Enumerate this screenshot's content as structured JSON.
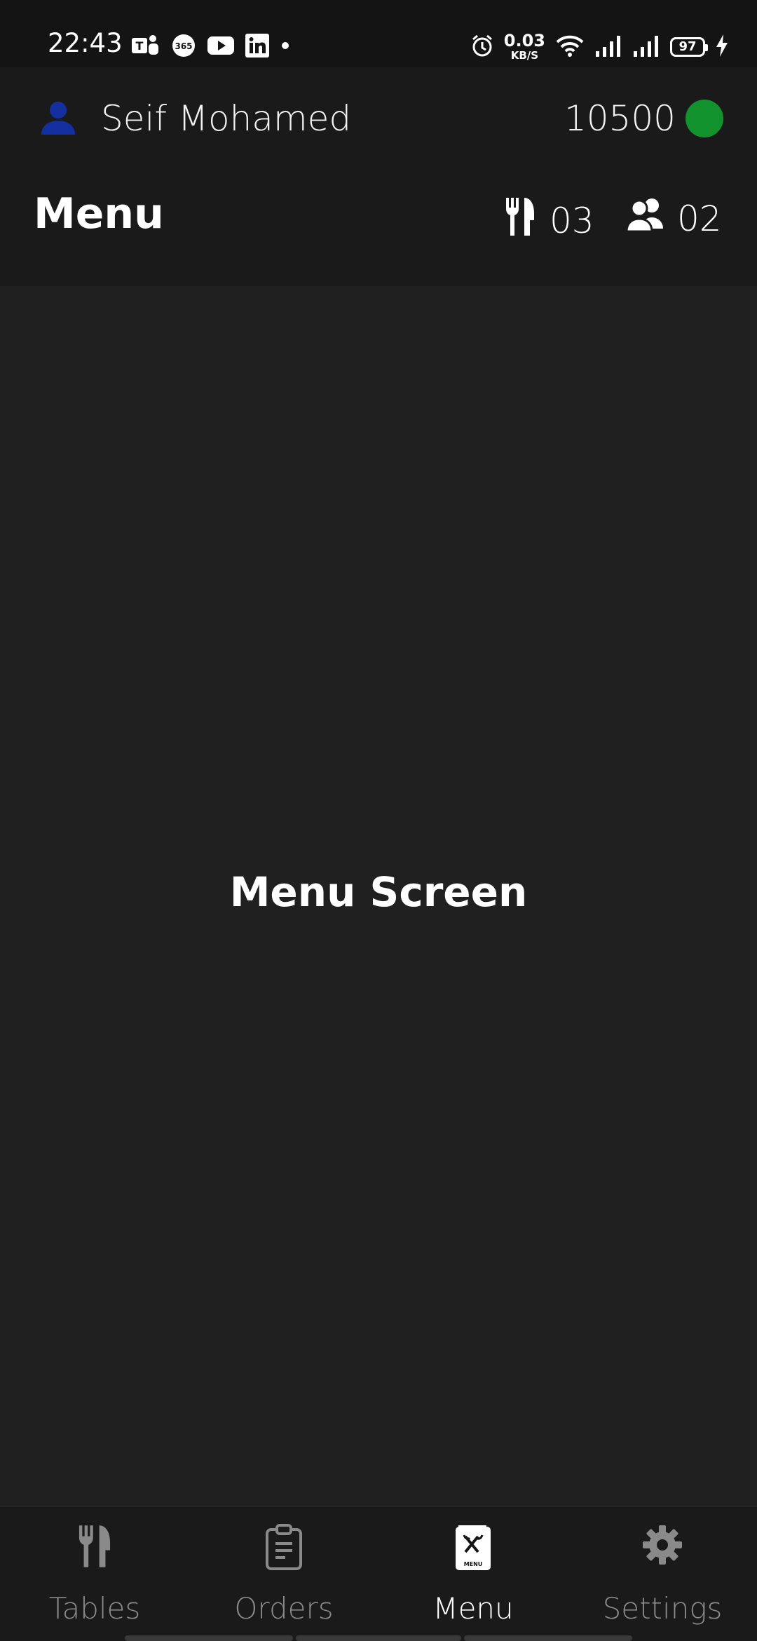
{
  "status_bar": {
    "time": "22:43",
    "notification_icons": [
      "teams-icon",
      "office-365-icon",
      "youtube-icon",
      "linkedin-icon",
      "dot-icon"
    ],
    "net_speed_value": "0.03",
    "net_speed_unit": "KB/S",
    "battery_level": "97",
    "charging": true
  },
  "header": {
    "user_name": "Seif Mohamed",
    "balance": "10500",
    "online_status_color": "#12922c",
    "avatar_color": "#1430a0",
    "title": "Menu",
    "tables_count": "03",
    "guests_count": "02"
  },
  "main": {
    "label": "Menu Screen"
  },
  "bottom_nav": {
    "items": [
      {
        "label": "Tables",
        "icon": "utensils-icon",
        "active": false
      },
      {
        "label": "Orders",
        "icon": "clipboard-icon",
        "active": false
      },
      {
        "label": "Menu",
        "icon": "menu-book-icon",
        "active": true
      },
      {
        "label": "Settings",
        "icon": "gear-icon",
        "active": false
      }
    ]
  },
  "colors": {
    "background": "#202020",
    "header_background": "#1a1a1a",
    "status_bar_background": "#141414",
    "inactive_nav": "#8a8a8a",
    "active_nav": "#ffffff"
  }
}
